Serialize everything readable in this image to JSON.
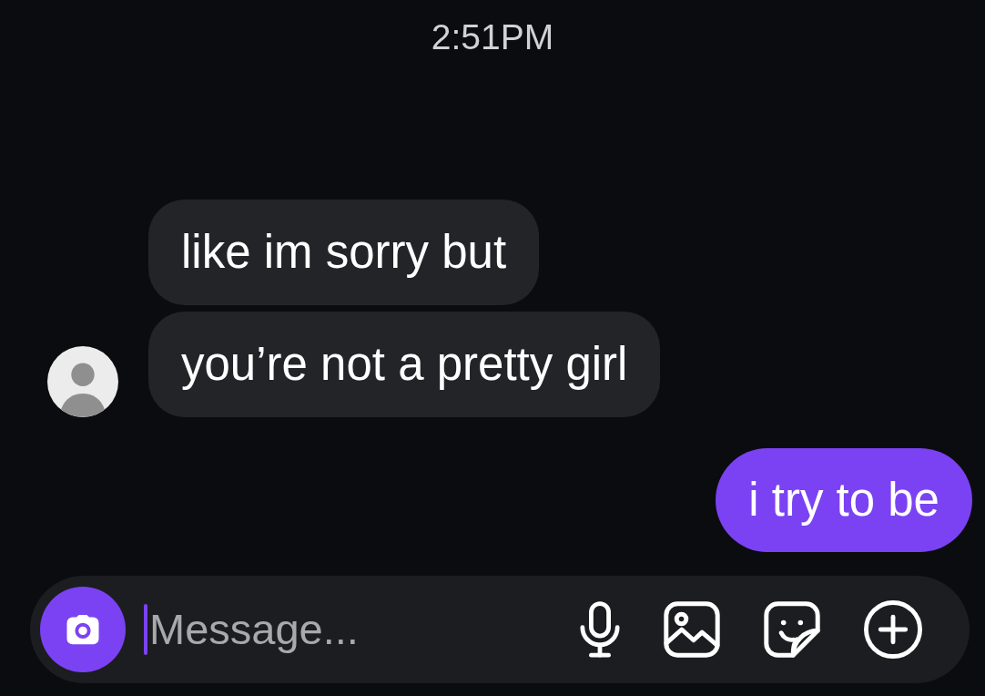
{
  "timestamp": "2:51PM",
  "messages": [
    {
      "kind": "received",
      "text": "like im sorry but",
      "avatar": false
    },
    {
      "kind": "received",
      "text": "you’re not a pretty girl",
      "avatar": true
    },
    {
      "kind": "sent",
      "text": "i try to be"
    }
  ],
  "composer": {
    "placeholder": "Message...",
    "focused": true
  }
}
